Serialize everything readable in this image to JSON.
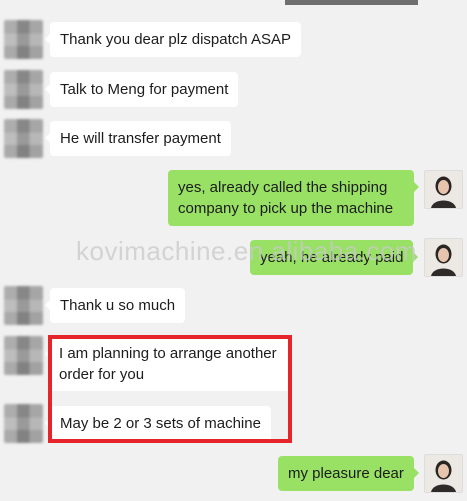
{
  "messages": [
    {
      "side": "in",
      "text": "Thank you dear plz dispatch ASAP"
    },
    {
      "side": "in",
      "text": "Talk to Meng for payment"
    },
    {
      "side": "in",
      "text": "He will transfer payment"
    },
    {
      "side": "out",
      "text": "yes, already called the shipping company to pick up the machine"
    },
    {
      "side": "out",
      "text": "yeah, he already paid"
    },
    {
      "side": "in",
      "text": "Thank u so much"
    },
    {
      "side": "in",
      "text": "I am planning to arrange another order for you"
    },
    {
      "side": "in",
      "text": "May be 2 or 3 sets of machine"
    },
    {
      "side": "out",
      "text": "my pleasure dear"
    }
  ],
  "watermark": "kovimachine.en.alibaba.com",
  "colors": {
    "background": "#f1f1f1",
    "incoming_bubble": "#ffffff",
    "outgoing_bubble": "#98e165",
    "highlight": "#e5252a"
  }
}
